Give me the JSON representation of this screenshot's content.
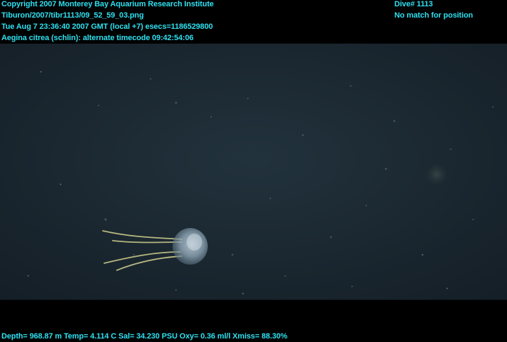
{
  "overlay": {
    "copyright": "Copyright 2007 Monterey Bay Aquarium Research Institute",
    "filename": "Tiburon/2007/tibr1113/09_52_59_03.png",
    "datetime": "Tue Aug  7 23:36:40 2007 GMT (local +7)  esecs=1186529800",
    "annotation": "Aegina citrea (schlin): alternate timecode 09:42:54:06",
    "dive": "Dive# 1113",
    "position": "No match for position",
    "sensors": "Depth= 968.87 m  Temp= 4.114 C  Sal= 34.230 PSU  Oxy= 0.36 ml/l  Xmiss= 88.30%"
  },
  "colors": {
    "overlay_text": "#2fe0f0",
    "water": "#1c2a34",
    "letterbox": "#000000"
  }
}
